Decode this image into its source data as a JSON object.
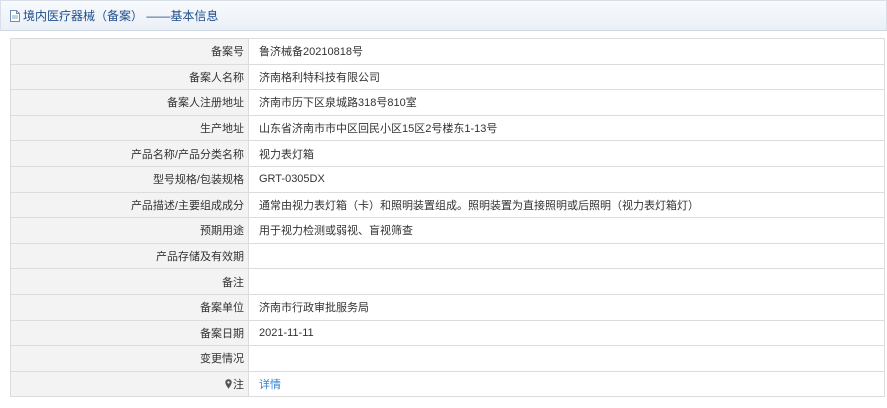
{
  "header": {
    "icon": "document-icon",
    "title": "境内医疗器械（备案） ——基本信息"
  },
  "rows": [
    {
      "label": "备案号",
      "value": "鲁济械备20210818号"
    },
    {
      "label": "备案人名称",
      "value": "济南格利特科技有限公司"
    },
    {
      "label": "备案人注册地址",
      "value": "济南市历下区泉城路318号810室"
    },
    {
      "label": "生产地址",
      "value": "山东省济南市市中区回民小区15区2号楼东1-13号"
    },
    {
      "label": "产品名称/产品分类名称",
      "value": "视力表灯箱"
    },
    {
      "label": "型号规格/包装规格",
      "value": "GRT-0305DX"
    },
    {
      "label": "产品描述/主要组成成分",
      "value": "通常由视力表灯箱（卡）和照明装置组成。照明装置为直接照明或后照明（视力表灯箱灯）"
    },
    {
      "label": "预期用途",
      "value": "用于视力检测或弱视、盲视筛查"
    },
    {
      "label": "产品存储及有效期",
      "value": ""
    },
    {
      "label": "备注",
      "value": ""
    },
    {
      "label": "备案单位",
      "value": "济南市行政审批服务局"
    },
    {
      "label": "备案日期",
      "value": "2021-11-11"
    },
    {
      "label": "变更情况",
      "value": ""
    }
  ],
  "note_row": {
    "icon": "map-pin-icon",
    "label": "注",
    "link_text": "详情"
  }
}
